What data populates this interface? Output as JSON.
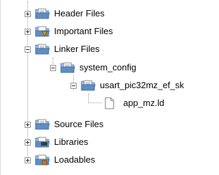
{
  "tree": {
    "nodes": [
      {
        "label": "Header Files",
        "icon": "folder-header-icon",
        "expanded": false
      },
      {
        "label": "Important Files",
        "icon": "folder-important-icon",
        "expanded": false
      },
      {
        "label": "Linker Files",
        "icon": "folder-icon",
        "expanded": true
      },
      {
        "label": "system_config",
        "icon": "folder-icon",
        "expanded": true
      },
      {
        "label": "usart_pic32mz_ef_sk",
        "icon": "folder-icon",
        "expanded": true
      },
      {
        "label": "app_mz.ld",
        "icon": "file-icon"
      },
      {
        "label": "Source Files",
        "icon": "folder-icon",
        "expanded": false
      },
      {
        "label": "Libraries",
        "icon": "folder-libraries-icon",
        "expanded": false
      },
      {
        "label": "Loadables",
        "icon": "folder-loadables-icon",
        "expanded": false
      }
    ]
  },
  "colors": {
    "folder_front": "#5e8ec4",
    "folder_back": "#9fc2e6",
    "folder_tab": "#7ea7d6",
    "page": "#ffffff",
    "important_badge": "#c89b2c",
    "libraries_badge": "#3a3a3a",
    "loadables_badge": "#d07a1c"
  }
}
